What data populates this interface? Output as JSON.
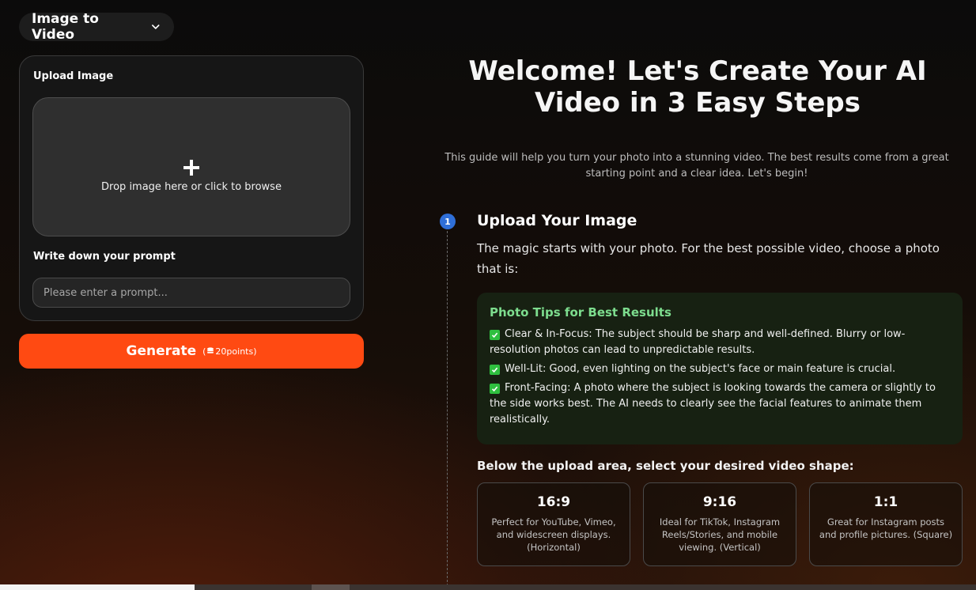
{
  "mode_selector": {
    "label": "Image to Video"
  },
  "upload": {
    "label": "Upload Image",
    "drop_text": "Drop image here or click to browse"
  },
  "prompt": {
    "label": "Write down your prompt",
    "placeholder": "Please enter a prompt..."
  },
  "generate": {
    "label": "Generate",
    "cost": "20points"
  },
  "hero": {
    "title_line1": "Welcome! Let's Create Your AI",
    "title_line2": "Video in 3 Easy Steps",
    "subtitle": "This guide will help you turn your photo into a stunning video. The best results come from a great starting point and a clear idea. Let's begin!"
  },
  "step1": {
    "number": "1",
    "title": "Upload Your Image",
    "description": "The magic starts with your photo. For the best possible video, choose a photo that is:"
  },
  "tips": {
    "title": "Photo Tips for Best Results",
    "items": [
      "Clear & In-Focus: The subject should be sharp and well-defined. Blurry or low-resolution photos can lead to unpredictable results.",
      "Well-Lit: Good, even lighting on the subject's face or main feature is crucial.",
      "Front-Facing: A photo where the subject is looking towards the camera or slightly to the side works best. The AI needs to clearly see the facial features to animate them realistically."
    ]
  },
  "shapes": {
    "heading": "Below the upload area, select your desired video shape:",
    "options": [
      {
        "ratio": "16:9",
        "description": "Perfect for YouTube, Vimeo, and widescreen displays. (Horizontal)"
      },
      {
        "ratio": "9:16",
        "description": "Ideal for TikTok, Instagram Reels/Stories, and mobile viewing. (Vertical)"
      },
      {
        "ratio": "1:1",
        "description": "Great for Instagram posts and profile pictures. (Square)"
      }
    ]
  },
  "colors": {
    "accent": "#ff4a12",
    "step_badge": "#2f6fd8",
    "tips_title": "#7ddd8e",
    "tips_background": "#172112"
  },
  "icons": {
    "mode_selector": "chevron-down-icon",
    "dropzone": "plus-icon",
    "generate_cost": "coin-icon",
    "tips": "check-icon"
  }
}
